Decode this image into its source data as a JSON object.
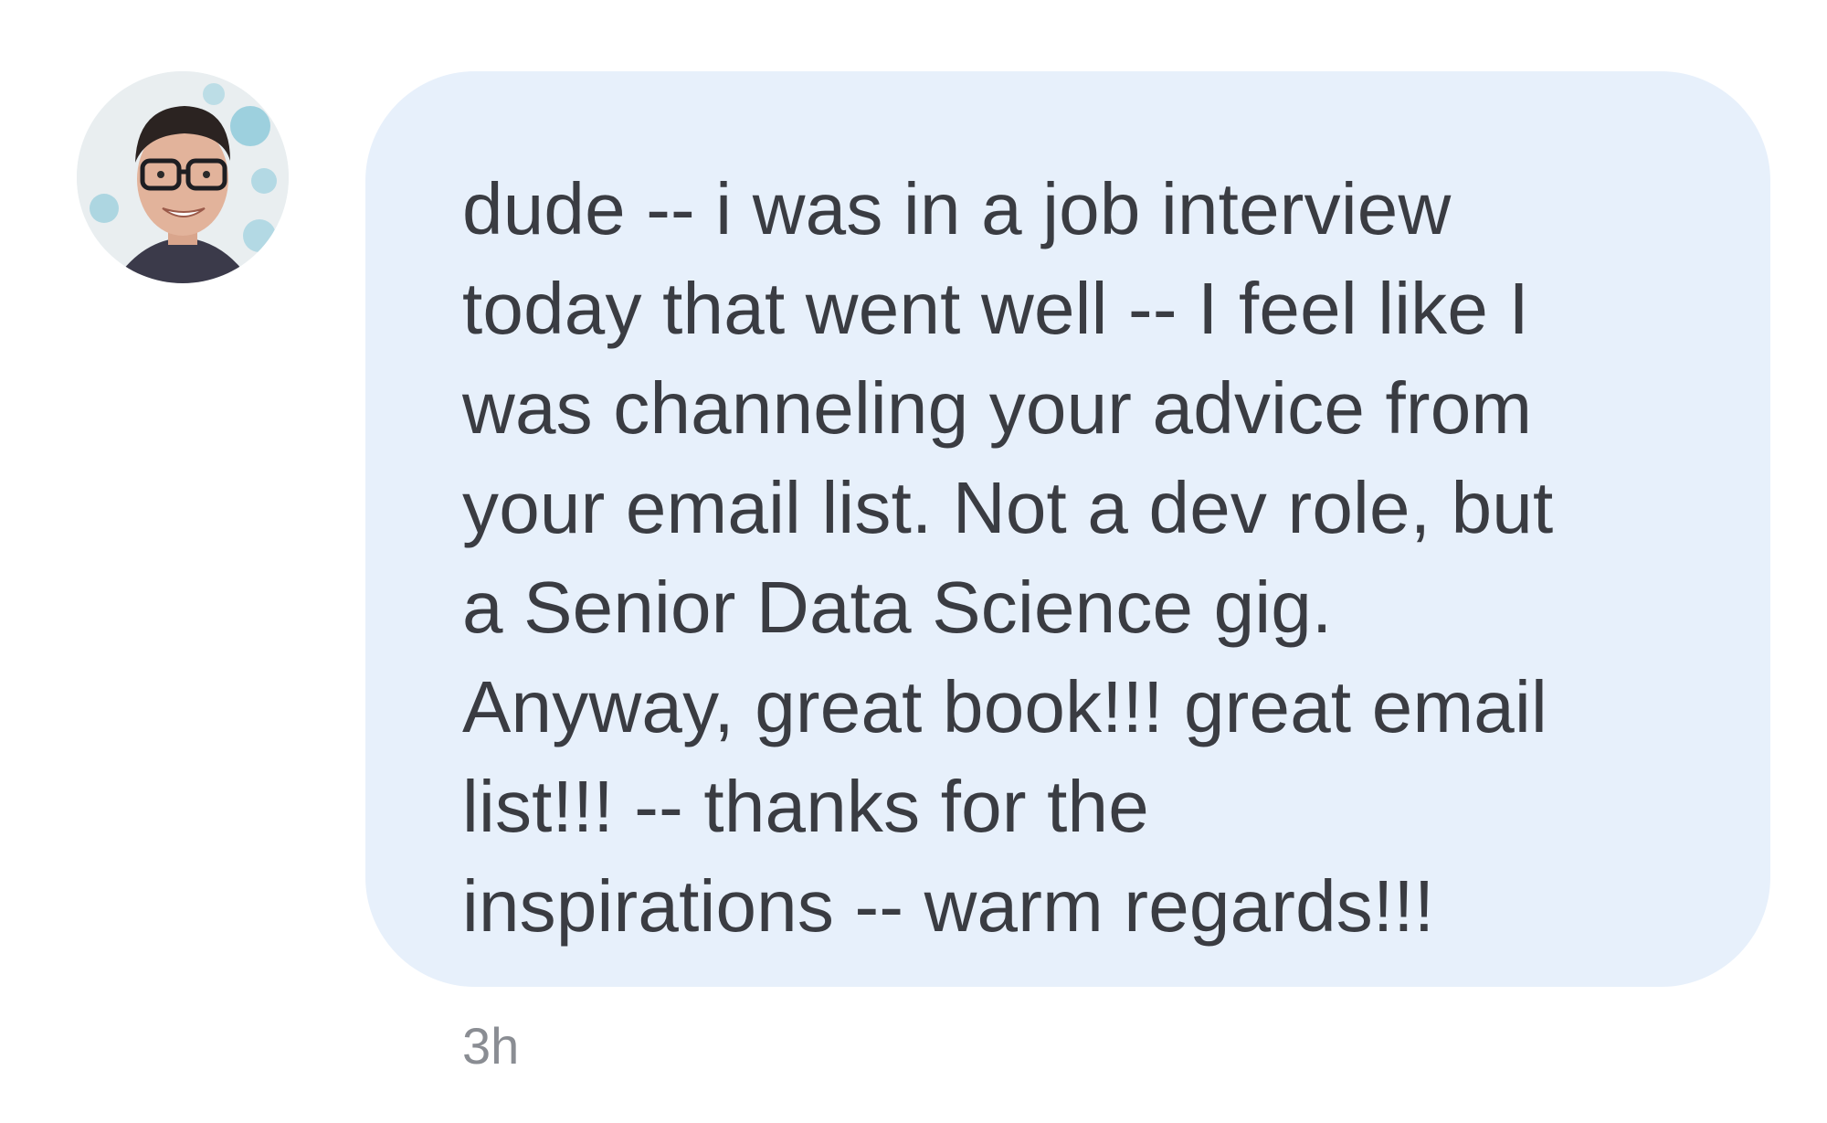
{
  "sender": {
    "avatar_icon": "user-avatar-photo"
  },
  "message": {
    "lines": [
      "dude -- i was in a job interview",
      "today that went well -- I feel like I",
      "was channeling your advice from",
      "your email list. Not a dev role, but",
      "a Senior Data Science gig.",
      "Anyway, great book!!! great email",
      "list!!! -- thanks for the",
      "inspirations -- warm regards!!!"
    ],
    "timestamp": "3h",
    "bubble_color": "#e7f0fb",
    "text_color": "#3a3c42",
    "timestamp_color": "#8a8d93"
  }
}
